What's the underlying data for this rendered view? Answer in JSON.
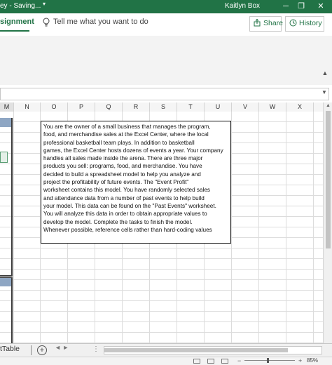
{
  "titlebar": {
    "left_text": "ey - Saving...",
    "user_name": "Kaitlyn Box",
    "min_glyph": "─",
    "restore_glyph": "❐",
    "close_glyph": "✕"
  },
  "ribbon": {
    "active_tab": "signment",
    "tell_me_placeholder": "Tell me what you want to do",
    "share_label": "Share",
    "history_label": "History"
  },
  "columns": [
    "M",
    "N",
    "O",
    "P",
    "Q",
    "R",
    "S",
    "T",
    "U",
    "V",
    "W",
    "X"
  ],
  "textbox": {
    "lines": [
      "You are the owner of a small business that manages the program,",
      "food, and merchandise sales at the Excel Center, where the local",
      "professional basketball team plays. In addition to basketball",
      "games, the Excel Center hosts dozens of events a year. Your company",
      "handles all sales made inside the arena. There are three major",
      "products you sell: programs, food, and merchandise. You have",
      "decided to build a spreadsheet model to help you analyze and",
      "project the profitability of future events. The \"Event Profit\"",
      "worksheet contains this model. You have randomly selected sales",
      "and attendance data from a number of past events to help build",
      "your model. This data can be found on the \"Past Events\" worksheet.",
      "You will analyze this data in order to obtain appropriate values to",
      "develop the model. Complete the tasks to finish the model.",
      "Whenever possible, reference cells rather than hard-coding values"
    ]
  },
  "sheet_tabs": {
    "visible_tab": "tTable",
    "add_glyph": "+",
    "nav_glyph": "◄ ►",
    "more_glyph": "⋮"
  },
  "status": {
    "zoom_level": "85%",
    "zoom_minus": "−",
    "zoom_plus": "+"
  },
  "colors": {
    "excel_green": "#217346",
    "frame_header_blue": "#8ea6c3"
  }
}
